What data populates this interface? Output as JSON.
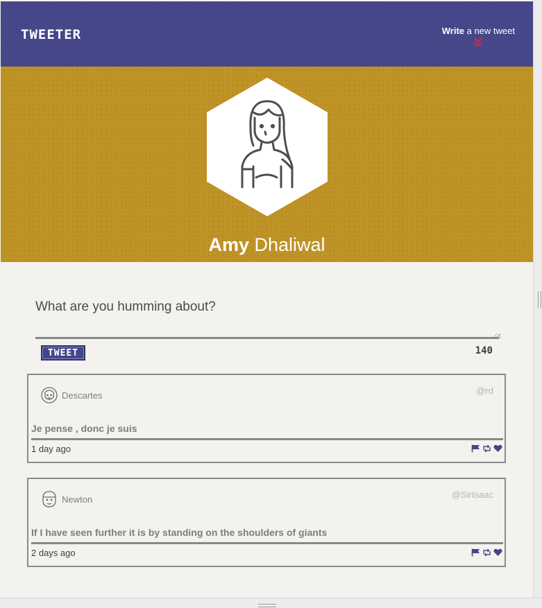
{
  "nav": {
    "logo": "TWEETER",
    "compose_bold": "Write",
    "compose_rest": " a new tweet",
    "arrow_icon": "double-chevron-down-icon",
    "arrow_color": "#e0253f"
  },
  "profile": {
    "first_name": "Amy",
    "last_name": " Dhaliwal",
    "avatar_icon": "woman-avatar-icon"
  },
  "composer": {
    "placeholder": "What are you humming about?",
    "button_label": "TWEET",
    "char_count": "140"
  },
  "tweets": [
    {
      "name": "Descartes",
      "handle": "@rd",
      "text": "Je pense , donc je suis",
      "time": "1 day ago",
      "avatar_icon": "man-avatar-icon"
    },
    {
      "name": "Newton",
      "handle": "@SirIsaac",
      "text": "If I have seen further it is by standing on the shoulders of giants",
      "time": "2 days ago",
      "avatar_icon": "man-avatar-icon"
    }
  ],
  "actions": [
    "flag-icon",
    "retweet-icon",
    "heart-icon"
  ],
  "colors": {
    "nav_bg": "#44468a",
    "banner_bg": "#be9224",
    "page_bg": "#f4f2ef",
    "accent": "#44468a"
  }
}
